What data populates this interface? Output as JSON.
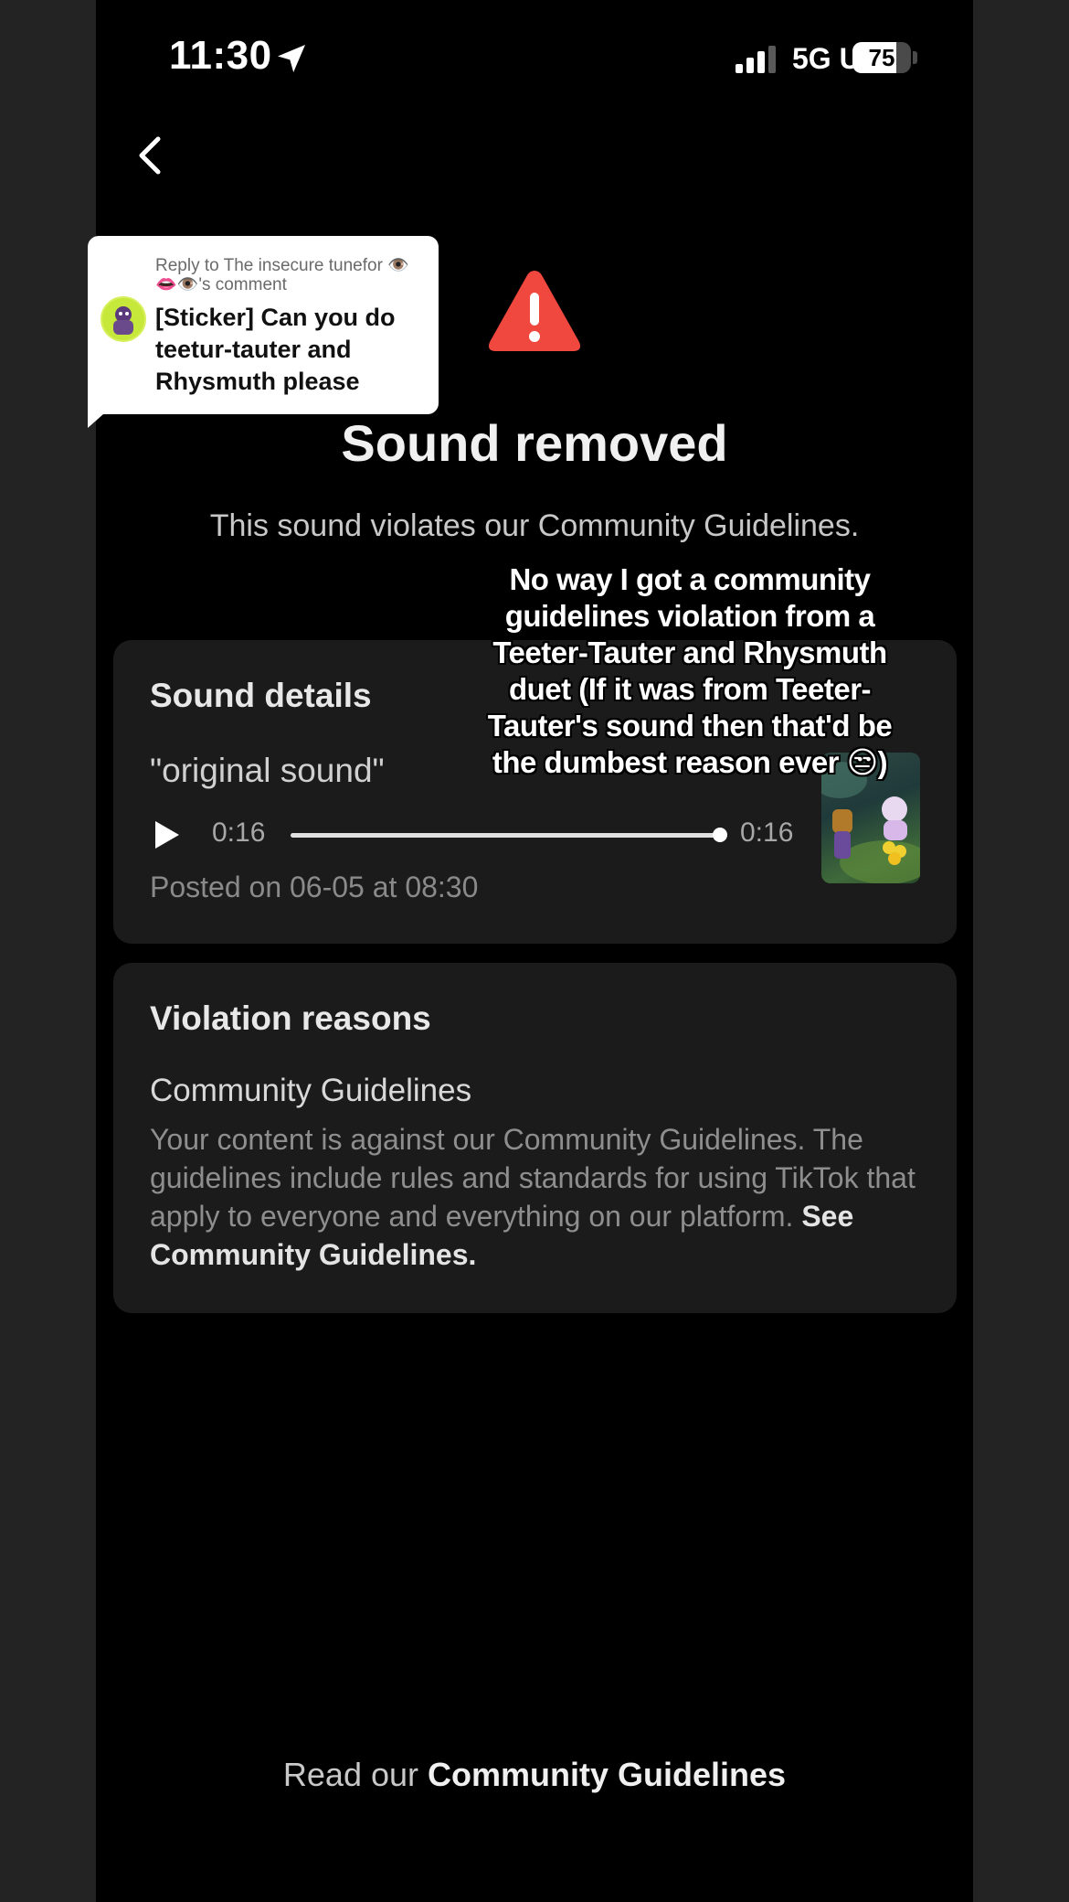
{
  "status_bar": {
    "time": "11:30",
    "network": "5G UC",
    "battery_percent": "75",
    "battery_level": 0.75
  },
  "page": {
    "title": "Sound removed",
    "subtitle": "This sound violates our Community Guidelines.",
    "accent_color": "#f0473e"
  },
  "sound_details": {
    "heading": "Sound details",
    "sound_name": "\"original sound\"",
    "elapsed": "0:16",
    "duration": "0:16",
    "progress": 1.0,
    "posted": "Posted on 06-05 at 08:30"
  },
  "violation": {
    "heading": "Violation reasons",
    "reason_title": "Community Guidelines",
    "reason_body": "Your content is against our Community Guidelines. The guidelines include rules and standards for using TikTok that apply to everyone and everything on our platform.",
    "reason_link": "See Community Guidelines."
  },
  "footer": {
    "prefix": "Read our",
    "link": "Community Guidelines"
  },
  "reply_sticker": {
    "context": "Reply to The insecure tunefor 👁️👄👁️'s comment",
    "text": "[Sticker] Can you do teetur-tauter and Rhysmuth please"
  },
  "caption": {
    "text": "No way I got a community guidelines violation from a Teeter-Tauter and Rhysmuth duet (If it was from Teeter-Tauter's sound then that'd be the dumbest reason ever 😒)"
  }
}
